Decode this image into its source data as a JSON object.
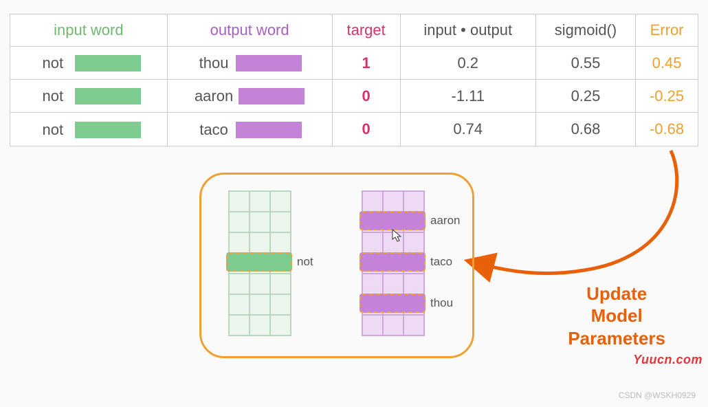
{
  "table": {
    "headers": {
      "input_word": "input word",
      "output_word": "output word",
      "target": "target",
      "input_output": "input • output",
      "sigmoid": "sigmoid()",
      "error": "Error"
    },
    "rows": [
      {
        "input": "not",
        "output": "thou",
        "target": "1",
        "io": "0.2",
        "sigmoid": "0.55",
        "error": "0.45"
      },
      {
        "input": "not",
        "output": "aaron",
        "target": "0",
        "io": "-1.11",
        "sigmoid": "0.25",
        "error": "-0.25"
      },
      {
        "input": "not",
        "output": "taco",
        "target": "0",
        "io": "0.74",
        "sigmoid": "0.68",
        "error": "-0.68"
      }
    ]
  },
  "diagram": {
    "input_highlight_label": "not",
    "output_labels": {
      "row0": "aaron",
      "row1": "taco",
      "row2": "thou"
    },
    "update_text": {
      "l1": "Update",
      "l2": "Model",
      "l3": "Parameters"
    }
  },
  "watermarks": {
    "csdn": "CSDN @WSKH0929",
    "site": "Yuucn.com"
  }
}
